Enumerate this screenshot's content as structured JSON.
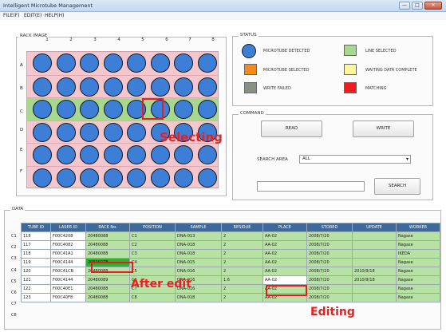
{
  "window": {
    "title": "Intelligent Microtube Management",
    "minimize": "—",
    "maximize": "□",
    "close": "✕"
  },
  "menu": [
    "FILE(F)",
    "EDIT(E)",
    "HELP(H)"
  ],
  "rack": {
    "title": "RACK IMAGE",
    "columns": [
      "1",
      "2",
      "3",
      "4",
      "5",
      "6",
      "7",
      "8"
    ],
    "rows": [
      "A",
      "B",
      "C",
      "D",
      "E",
      "F"
    ],
    "selected_row": "C",
    "selected_well": "C6",
    "annotation": "Selecting"
  },
  "status": {
    "title": "STATUS",
    "items": [
      {
        "label": "MICROTUBE DETECTED",
        "color": "#3d7fd6"
      },
      {
        "label": "LINE SELECTED",
        "color": "#a7d88d"
      },
      {
        "label": "MICROTUBE SELECTED",
        "color": "#f48a1e"
      },
      {
        "label": "WAITING DATA COMPLETE",
        "color": "#fff59a"
      },
      {
        "label": "WRITE FAILED",
        "color": "#8a8f86"
      },
      {
        "label": "MATCHING",
        "color": "#ee1c1c"
      }
    ]
  },
  "command": {
    "title": "COMMAND",
    "read": "READ",
    "write": "WRITE",
    "search_area_label": "SEARCH AREA",
    "search_area_value": "ALL",
    "search_value": "",
    "search_button": "SEARCH"
  },
  "data": {
    "title": "DATA",
    "headers": [
      "TUBE ID",
      "LASER ID",
      "RACK No.",
      "POSITION",
      "SAMPLE",
      "RESIDUE",
      "PLACE",
      "STORED",
      "UPDATE",
      "WORKER"
    ],
    "row_labels": [
      "C1",
      "C2",
      "C3",
      "C4",
      "C5",
      "C6",
      "C7",
      "C8"
    ],
    "rows": [
      [
        "118",
        "F00C4208",
        "20480088",
        "C1",
        "DNA-013",
        "2",
        "AA-02",
        "2008/7/20",
        "",
        "Nagase"
      ],
      [
        "117",
        "F00C4082",
        "20480088",
        "C2",
        "DNA-018",
        "2",
        "AA-02",
        "2008/7/20",
        "",
        "Nagase"
      ],
      [
        "118",
        "F00C41A1",
        "20480088",
        "C3",
        "DNA-018",
        "2",
        "AA-02",
        "2008/7/20",
        "",
        "IKEDA"
      ],
      [
        "119",
        "F00C4144",
        "20500278",
        "C4",
        "DNA-015",
        "2",
        "AA-02",
        "2008/7/20",
        "",
        "Nagase"
      ],
      [
        "120",
        "F00C41CB",
        "20480088",
        "C5",
        "DNA-016",
        "2",
        "AA-02",
        "2008/7/20",
        "2010/9/18",
        "Nagase"
      ],
      [
        "121",
        "F00C4144",
        "20480089",
        "C6",
        "DNA-016",
        "1.6",
        "AA-02",
        "2008/7/20",
        "2010/9/18",
        "Nagase"
      ],
      [
        "122",
        "F00C40E1",
        "20480088",
        "C7",
        "DNA-016",
        "2",
        "AA-02",
        "2008/7/20",
        "",
        "Nagase"
      ],
      [
        "123",
        "F00C40F8",
        "20480088",
        "C8",
        "DNA-018",
        "2",
        "AA-02",
        "2008/7/20",
        "",
        "Nagase"
      ]
    ],
    "annotation_after": "After edit",
    "annotation_editing": "Editing"
  }
}
